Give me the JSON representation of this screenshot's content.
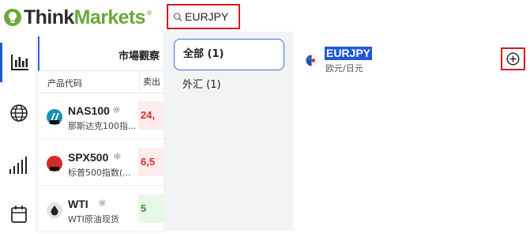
{
  "header": {
    "logo_text_main": "Think",
    "logo_text_accent": "Markets",
    "logo_reg": "®"
  },
  "search": {
    "value": "EURJPY",
    "icon": "search-icon"
  },
  "rail": {
    "items": [
      {
        "icon": "chart-bars-icon",
        "active": true
      },
      {
        "icon": "globe-icon",
        "active": false
      },
      {
        "icon": "signal-bars-icon",
        "active": false
      },
      {
        "icon": "calendar-icon",
        "active": false
      }
    ]
  },
  "watchlist": {
    "title": "市場觀察",
    "col_code": "产品代码",
    "col_sell": "卖出",
    "rows": [
      {
        "symbol": "NAS100",
        "desc": "那斯达克100指...",
        "price": "24,",
        "trend": "red",
        "icon": "nas100-icon"
      },
      {
        "symbol": "SPX500",
        "desc": "标普500指数(...",
        "price": "6,5",
        "trend": "red",
        "icon": "spx500-icon"
      },
      {
        "symbol": "WTI",
        "desc": "WTI原油现货",
        "price": "5",
        "trend": "green",
        "icon": "oil-drop-icon"
      }
    ]
  },
  "categories": [
    {
      "label": "全部 (1)",
      "active": true
    },
    {
      "label": "外汇 (1)",
      "active": false
    }
  ],
  "results": [
    {
      "symbol": "EURJPY",
      "desc": "欧元/日元",
      "icon": "eu-jp-flag-icon"
    }
  ],
  "colors": {
    "accent_blue": "#1f58d6",
    "highlight_red": "#d61a22",
    "brand_green": "#6aa83a"
  }
}
